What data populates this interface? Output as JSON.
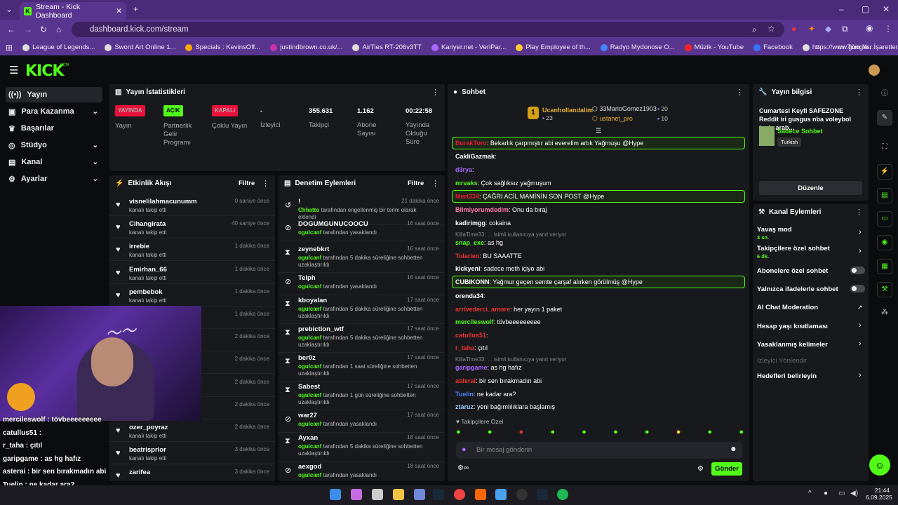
{
  "browser": {
    "tab_title": "Stream - Kick Dashboard",
    "url": "dashboard.kick.com/stream",
    "bookmarks": [
      "League of Legends...",
      "Sword Art Online 1...",
      "Specials : KevinsOff...",
      "justindbrown.co.uk/...",
      "AirTies RT-206v3TT",
      "Kariyer.net - VeriPar...",
      "Play Employee of th...",
      "Radyo Mydonose O...",
      "Müzik - YouTube",
      "Facebook",
      "https://www.google..."
    ],
    "all_bookmarks": "Tüm Yer İşaretleri"
  },
  "logo": "KICK",
  "sidebar": {
    "items": [
      {
        "label": "Yayın"
      },
      {
        "label": "Para Kazanma"
      },
      {
        "label": "Başarılar"
      },
      {
        "label": "Stüdyo"
      },
      {
        "label": "Kanal"
      },
      {
        "label": "Ayarlar"
      }
    ]
  },
  "stats": {
    "title": "Yayın İstatistikleri",
    "items": [
      {
        "badge": "YAYINDA",
        "label": "Yayın"
      },
      {
        "badge": "AÇIK",
        "label": "Partnerlik Gelir Programı"
      },
      {
        "badge": "KAPALI",
        "label": "Çoklu Yayın"
      },
      {
        "value": "-",
        "label": "İzleyici"
      },
      {
        "value": "355.631",
        "label": "Takipçi"
      },
      {
        "value": "1.162",
        "label": "Abone Sayısı"
      },
      {
        "value": "00:22:58",
        "label": "Yayında Olduğu Süre"
      }
    ]
  },
  "activity": {
    "title": "Etkinlik Akışı",
    "filter": "Filtre",
    "rows": [
      {
        "name": "visnelilahmacunumm",
        "sub": "kanalı takip etti",
        "time": "0 saniye önce"
      },
      {
        "name": "Cihangirata",
        "sub": "kanalı takip etti",
        "time": "40 saniye önce"
      },
      {
        "name": "irrebie",
        "sub": "kanalı takip etti",
        "time": "1 dakika önce"
      },
      {
        "name": "Emirhan_66",
        "sub": "kanalı takip etti",
        "time": "1 dakika önce"
      },
      {
        "name": "pembebok",
        "sub": "kanalı takip etti",
        "time": "1 dakika önce"
      },
      {
        "name": "",
        "sub": "",
        "time": "1 dakika önce"
      },
      {
        "name": "",
        "sub": "",
        "time": "2 dakika önce"
      },
      {
        "name": "",
        "sub": "",
        "time": "2 dakika önce"
      },
      {
        "name": "",
        "sub": "",
        "time": "2 dakika önce"
      },
      {
        "name": "",
        "sub": "",
        "time": "2 dakika önce"
      },
      {
        "name": "ozer_poyraz",
        "sub": "kanalı takip etti",
        "time": "2 dakika önce"
      },
      {
        "name": "beatrisprior",
        "sub": "kanalı takip etti",
        "time": "3 dakika önce"
      },
      {
        "name": "zarifea",
        "sub": "",
        "time": "3 dakika önce"
      }
    ]
  },
  "moderation": {
    "title": "Denetim Eylemleri",
    "filter": "Filtre",
    "rows": [
      {
        "name": "!",
        "who": "Chhatto",
        "sub": " tarafından engellenmiş bir terim olarak eklendi",
        "time": "21 dakika önce"
      },
      {
        "name": "DOGUMGUNUCOOCU",
        "who": "ogulcanf",
        "sub": " tarafından yasaklandı",
        "time": "16 saat önce"
      },
      {
        "name": "zeynebkrt",
        "who": "ogulcanf",
        "sub": " tarafından 5 dakika süreliğine sohbetten uzaklaştırıldı",
        "time": "16 saat önce"
      },
      {
        "name": "Telph",
        "who": "ogulcanf",
        "sub": " tarafından yasaklandı",
        "time": "16 saat önce"
      },
      {
        "name": "kboyalan",
        "who": "ogulcanf",
        "sub": " tarafından 5 dakika süreliğine sohbetten uzaklaştırıldı",
        "time": "17 saat önce"
      },
      {
        "name": "prebiction_wtf",
        "who": "ogulcanf",
        "sub": " tarafından 5 dakika süreliğine sohbetten uzaklaştırıldı",
        "time": "17 saat önce"
      },
      {
        "name": "ber0z",
        "who": "ogulcanf",
        "sub": " tarafından 1 saat süreliğine sohbetten uzaklaştırıldı",
        "time": "17 saat önce"
      },
      {
        "name": "Sabest",
        "who": "ogulcanf",
        "sub": " tarafından 1 gün süreliğine sohbetten uzaklaştırıldı",
        "time": "17 saat önce"
      },
      {
        "name": "war27",
        "who": "ogulcanf",
        "sub": " tarafından yasaklandı",
        "time": "17 saat önce"
      },
      {
        "name": "Ayxan",
        "who": "ogulcanf",
        "sub": " tarafından 5 dakika süreliğine sohbetten uzaklaştırıldı",
        "time": "18 saat önce"
      },
      {
        "name": "aexgod",
        "who": "ogulcanf",
        "sub": " tarafından yasaklandı",
        "time": "18 saat önce"
      }
    ]
  },
  "chat": {
    "title": "Sohbet",
    "leaders": [
      {
        "rank": "1",
        "name": "Ucanhollandalim",
        "count": "23"
      },
      {
        "name": "33MarioGomez1903",
        "count": "20"
      },
      {
        "name": "ustanet_pro",
        "count": "10"
      }
    ],
    "messages": [
      {
        "user": "BurakToro",
        "text": ": Bekarlık çarpmıştır abi everelim artık Yağmuşu @Hype",
        "hl": true
      },
      {
        "user": "CakliGazmak",
        "text": ":"
      },
      {
        "user": "d3rya",
        "text": ":"
      },
      {
        "user": "mrvaks",
        "text": ": Çok sağlıksız yağmuşum"
      },
      {
        "user": "Mert334",
        "text": ": ÇAĞRI ACİL MAMİNİN SON POST @Hype",
        "hl": true
      },
      {
        "user": "Bilmiyorumdedim",
        "text": ": Onu da bıraj"
      },
      {
        "user": "kadirimgg",
        "text": ": cokaina"
      },
      {
        "reply": "KillaTime33: ... isimli kullanıcıya yanıt veriyor"
      },
      {
        "user": "snap_exe",
        "text": ": as hg"
      },
      {
        "user": "Tularien",
        "text": ": BU SAAATTE"
      },
      {
        "user": "kickyeni",
        "text": ": sadece meth içiyo abi"
      },
      {
        "user": "CUBIKONN",
        "text": ": Yağmur geçen semte çarşaf alırken görülmüş @Hype",
        "hl": true
      },
      {
        "user": "orenda34",
        "text": ":"
      },
      {
        "user": "arrivederci_amore",
        "text": ": her yayın 1 paket"
      },
      {
        "user": "mercileswolf",
        "text": ": tövbeeeeeeeee"
      },
      {
        "user": "catullus51",
        "text": ":"
      },
      {
        "user": "r_taha",
        "text": ": çıtıl"
      },
      {
        "reply": "KillaTime33: ... isimli kullanıcıya yanıt veriyor"
      },
      {
        "user": "garipgame",
        "text": ": as hg hafız"
      },
      {
        "user": "asterai",
        "text": ": bir sen bırakmadın abi"
      },
      {
        "user": "Tuelin",
        "text": ": ne kadar ara?"
      },
      {
        "user": "ztaruz",
        "text": ": yeni bağımlılıklara başlamış"
      }
    ],
    "followers_only": "Takipçilere Özel",
    "placeholder": "Bir mesaj gönderin",
    "send": "Gönder"
  },
  "info": {
    "title": "Yayın bilgisi",
    "stream_title": "Cumartesi Keyfi SAFEZONE Reddit iri gusgus nba voleybol tenis arab...",
    "category": "Sadece Sohbet",
    "tag": "Turkish",
    "edit": "Düzenle"
  },
  "actions": {
    "title": "Kanal Eylemleri",
    "items": [
      {
        "label": "Yavaş mod",
        "sub": "3 sn."
      },
      {
        "label": "Takipçilere özel sohbet",
        "sub": "6 dk."
      },
      {
        "label": "Abonelere özel sohbet"
      },
      {
        "label": "Yalnızca ifadelerle sohbet"
      },
      {
        "label": "AI Chat Moderation"
      },
      {
        "label": "Hesap yaşı kısıtlaması"
      },
      {
        "label": "Yasaklanmış kelimeler"
      },
      {
        "label": "İzleyici Yönlendir"
      },
      {
        "label": "Hedefleri belirleyin"
      }
    ]
  },
  "overlay": [
    "mercileswolf : tövbeeeeeeeee",
    "catullus51 :",
    "r_taha : çıtıl",
    "garipgame : as hg hafız",
    "asterai : bir sen bırakmadın abi",
    "Tuelin : ne kadar ara?",
    "ztaruz : yeni bağımlılıklara başlamış"
  ],
  "clock": {
    "time": "21:44",
    "date": "6.09.2025"
  },
  "colors": {
    "accent": "#53fc18",
    "live": "#e9113c",
    "browser": "#5a3590"
  }
}
